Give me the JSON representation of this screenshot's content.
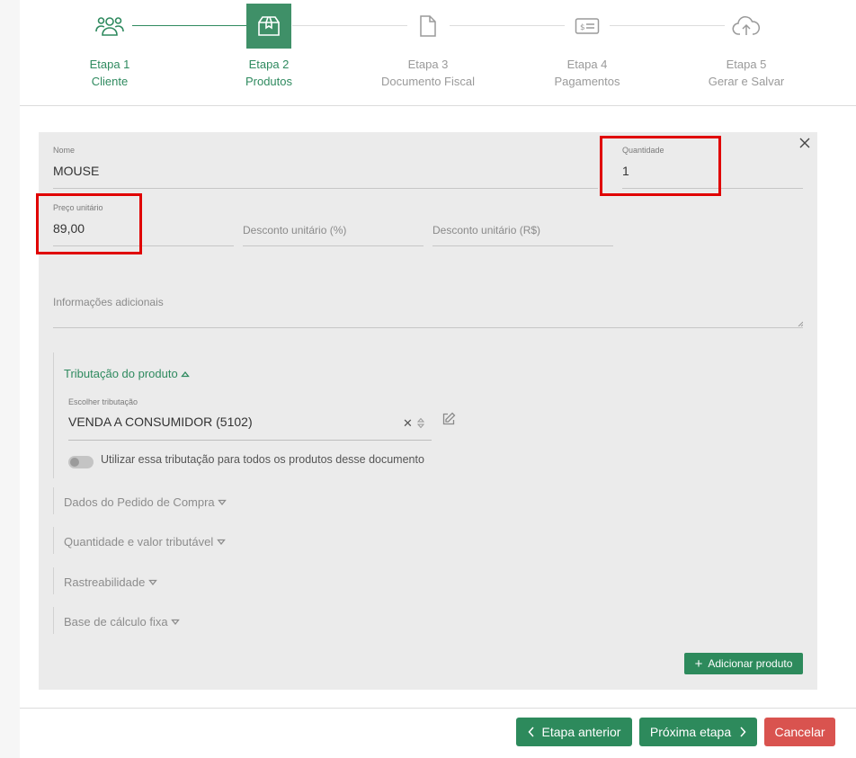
{
  "steps": [
    {
      "title": "Etapa 1",
      "subtitle": "Cliente",
      "state": "done",
      "icon": "users-icon"
    },
    {
      "title": "Etapa 2",
      "subtitle": "Produtos",
      "state": "active",
      "icon": "box-icon"
    },
    {
      "title": "Etapa 3",
      "subtitle": "Documento Fiscal",
      "state": "pending",
      "icon": "document-icon"
    },
    {
      "title": "Etapa 4",
      "subtitle": "Pagamentos",
      "state": "pending",
      "icon": "bill-icon"
    },
    {
      "title": "Etapa 5",
      "subtitle": "Gerar e Salvar",
      "state": "pending",
      "icon": "cloud-upload-icon"
    }
  ],
  "product": {
    "name_label": "Nome",
    "name_value": "MOUSE",
    "quantity_label": "Quantidade",
    "quantity_value": "1",
    "unit_price_label": "Preço unitário",
    "unit_price_value": "89,00",
    "discount_pct_placeholder": "Desconto unitário (%)",
    "discount_value_placeholder": "Desconto unitário (R$)",
    "additional_info_placeholder": "Informações adicionais"
  },
  "taxation": {
    "section_title": "Tributação do produto",
    "choose_label": "Escolher tributação",
    "choose_value": "VENDA A CONSUMIDOR (5102)",
    "toggle_label": "Utilizar essa tributação para todos os produtos desse documento"
  },
  "collapsed_sections": [
    "Dados do Pedido de Compra",
    "Quantidade e valor tributável",
    "Rastreabilidade",
    "Base de cálculo fixa"
  ],
  "buttons": {
    "add_product": "Adicionar produto",
    "previous": "Etapa anterior",
    "next": "Próxima etapa",
    "cancel": "Cancelar"
  },
  "colors": {
    "accent": "#2d8a5c",
    "danger": "#d9534f",
    "highlight": "#e00000"
  }
}
